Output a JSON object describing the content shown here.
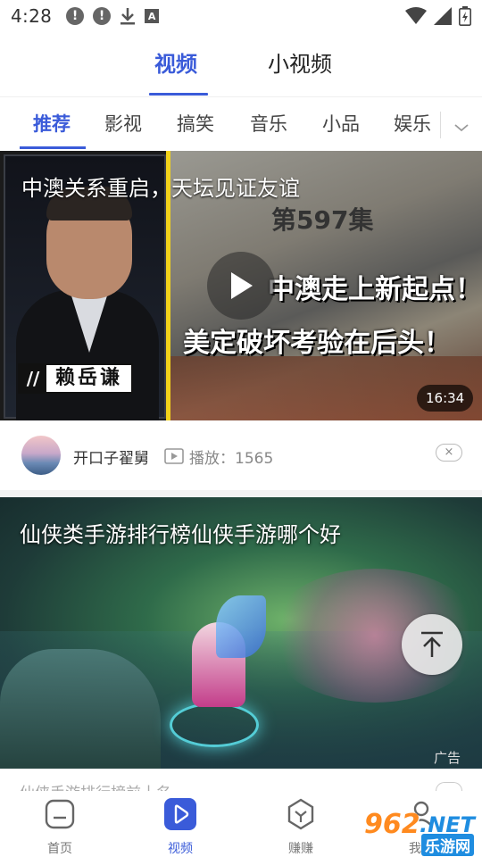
{
  "status_bar": {
    "time": "4:28",
    "alert_icon_glyph": "!",
    "a_icon_glyph": "A"
  },
  "primary_tabs": [
    {
      "label": "视频",
      "active": true
    },
    {
      "label": "小视频",
      "active": false
    }
  ],
  "categories": [
    {
      "label": "推荐",
      "active": true
    },
    {
      "label": "影视",
      "active": false
    },
    {
      "label": "搞笑",
      "active": false
    },
    {
      "label": "音乐",
      "active": false
    },
    {
      "label": "小品",
      "active": false
    },
    {
      "label": "娱乐",
      "active": false
    }
  ],
  "video_card": {
    "title": "中澳关系重启，天坛见证友谊",
    "episode": "第597集",
    "caption_line1": "中澳走上新起点！",
    "caption_line2": "美定破坏考验在后头！",
    "nameplate_slash": "//",
    "nameplate_name": "赖岳谦",
    "duration": "16:34",
    "author": "开口子翟舅",
    "plays": "播放：1565",
    "close_glyph": "×"
  },
  "ad_card": {
    "title": "仙侠类手游排行榜仙侠手游哪个好",
    "tag": "广告",
    "subtitle": "仙侠手游排行榜前十名"
  },
  "bottom_nav": [
    {
      "label": "首页",
      "icon": "home-icon",
      "active": false
    },
    {
      "label": "视频",
      "icon": "video-play-icon",
      "active": true
    },
    {
      "label": "赚赚",
      "icon": "earn-icon",
      "active": false
    },
    {
      "label": "我的",
      "icon": "profile-icon",
      "active": false
    }
  ],
  "watermark": {
    "num": "962",
    "net": ".NET",
    "cn": "乐游网"
  },
  "colors": {
    "accent": "#3a5bd9",
    "text": "#222222",
    "muted": "#888888"
  }
}
